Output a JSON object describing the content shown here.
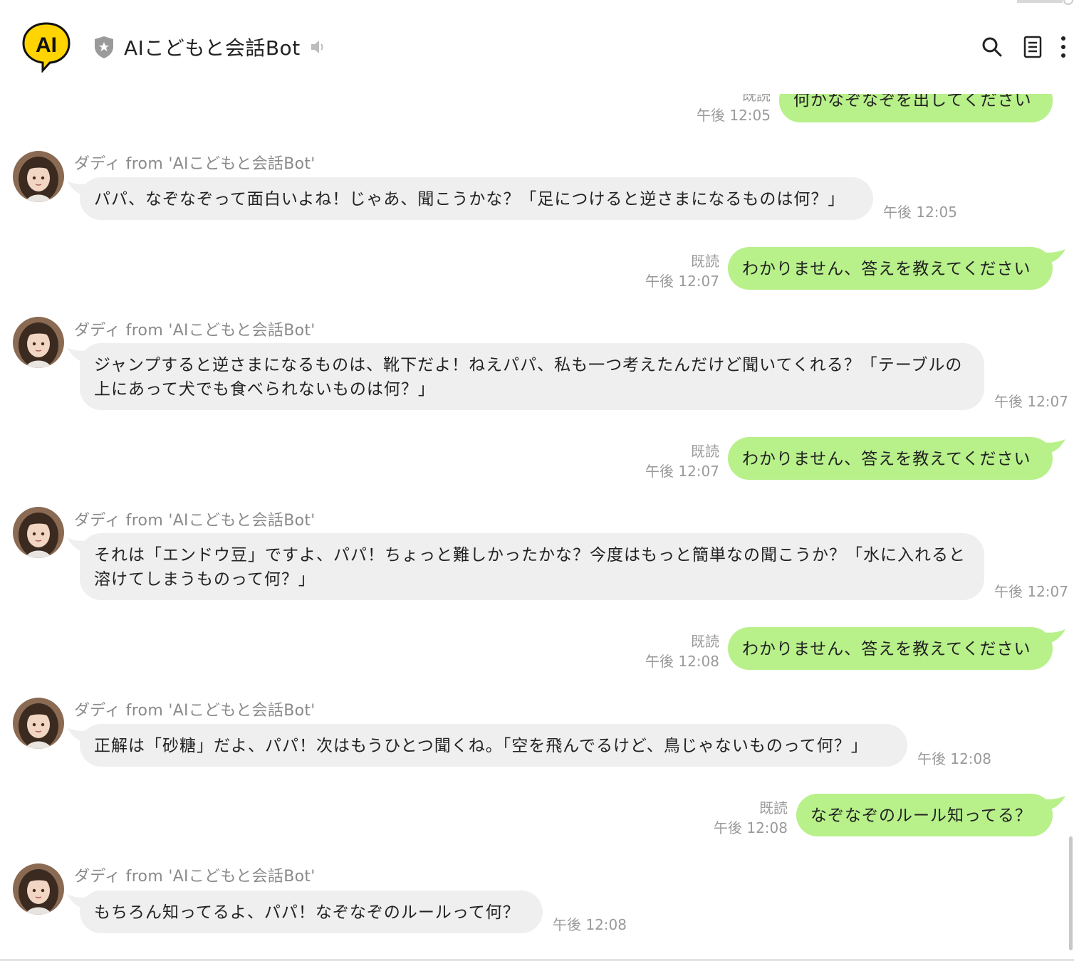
{
  "header": {
    "logo_text": "AI",
    "title": "AIこどもと会話Bot",
    "colors": {
      "logo_yellow": "#ffd400",
      "logo_outline": "#111111"
    }
  },
  "colors": {
    "outgoing_bubble": "#b8f08a",
    "incoming_bubble": "#efefef",
    "meta_text": "#9a9a9a"
  },
  "messages": [
    {
      "side": "out",
      "text": "何かなぞなぞを出してください",
      "read": "既読",
      "time": "午後 12:05"
    },
    {
      "side": "in",
      "sender": "ダディ from 'AIこどもと会話Bot'",
      "text": "パパ、なぞなぞって面白いよね！じゃあ、聞こうかな？「足につけると逆さまになるものは何？」",
      "time": "午後 12:05"
    },
    {
      "side": "out",
      "text": "わかりません、答えを教えてください",
      "read": "既読",
      "time": "午後 12:07"
    },
    {
      "side": "in",
      "sender": "ダディ from 'AIこどもと会話Bot'",
      "text": "ジャンプすると逆さまになるものは、靴下だよ！ねえパパ、私も一つ考えたんだけど聞いてくれる？「テーブルの上にあって犬でも食べられないものは何？」",
      "time": "午後 12:07"
    },
    {
      "side": "out",
      "text": "わかりません、答えを教えてください",
      "read": "既読",
      "time": "午後 12:07"
    },
    {
      "side": "in",
      "sender": "ダディ from 'AIこどもと会話Bot'",
      "text": "それは「エンドウ豆」ですよ、パパ！ちょっと難しかったかな？今度はもっと簡単なの聞こうか？「水に入れると溶けてしまうものって何？」",
      "time": "午後 12:07"
    },
    {
      "side": "out",
      "text": "わかりません、答えを教えてください",
      "read": "既読",
      "time": "午後 12:08"
    },
    {
      "side": "in",
      "sender": "ダディ from 'AIこどもと会話Bot'",
      "text": "正解は「砂糖」だよ、パパ！次はもうひとつ聞くね。「空を飛んでるけど、鳥じゃないものって何？」",
      "time": "午後 12:08"
    },
    {
      "side": "out",
      "text": "なぞなぞのルール知ってる？",
      "read": "既読",
      "time": "午後 12:08"
    },
    {
      "side": "in",
      "sender": "ダディ from 'AIこどもと会話Bot'",
      "text": "もちろん知ってるよ、パパ！なぞなぞのルールって何？",
      "time": "午後 12:08"
    }
  ]
}
